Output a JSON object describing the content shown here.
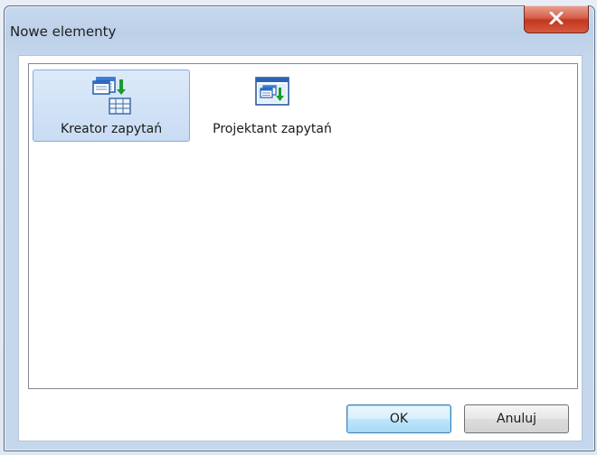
{
  "window": {
    "title": "Nowe elementy",
    "close_icon": "close-x-icon"
  },
  "items": [
    {
      "label": "Kreator zapytań",
      "icon": "query-wizard-icon",
      "selected": true
    },
    {
      "label": "Projektant zapytań",
      "icon": "query-designer-icon",
      "selected": false
    }
  ],
  "buttons": {
    "ok_label": "OK",
    "cancel_label": "Anuluj"
  },
  "colors": {
    "selection": "#c9dcf4",
    "close_button": "#c2371f",
    "icon_blue": "#1f5fb0",
    "icon_green": "#1a9a2a"
  }
}
